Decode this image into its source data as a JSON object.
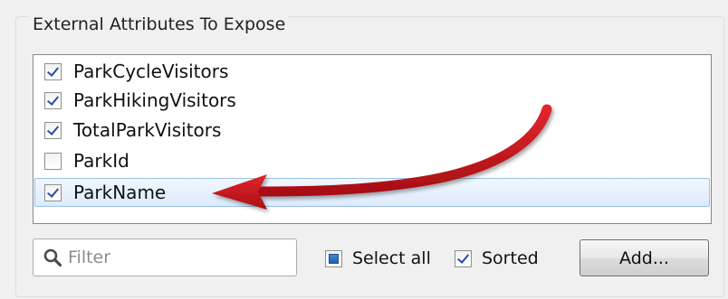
{
  "group": {
    "title": "External Attributes To Expose"
  },
  "attributes": [
    {
      "label": "ParkCycleVisitors",
      "checked": true
    },
    {
      "label": "ParkHikingVisitors",
      "checked": true
    },
    {
      "label": "TotalParkVisitors",
      "checked": true
    },
    {
      "label": "ParkId",
      "checked": false
    },
    {
      "label": "ParkName",
      "checked": true,
      "selected": true
    }
  ],
  "filter": {
    "placeholder": "Filter"
  },
  "options": {
    "select_all_label": "Select all",
    "sorted_label": "Sorted"
  },
  "buttons": {
    "add_label": "Add..."
  },
  "annotation": {
    "arrow_color": "#c0151b"
  }
}
